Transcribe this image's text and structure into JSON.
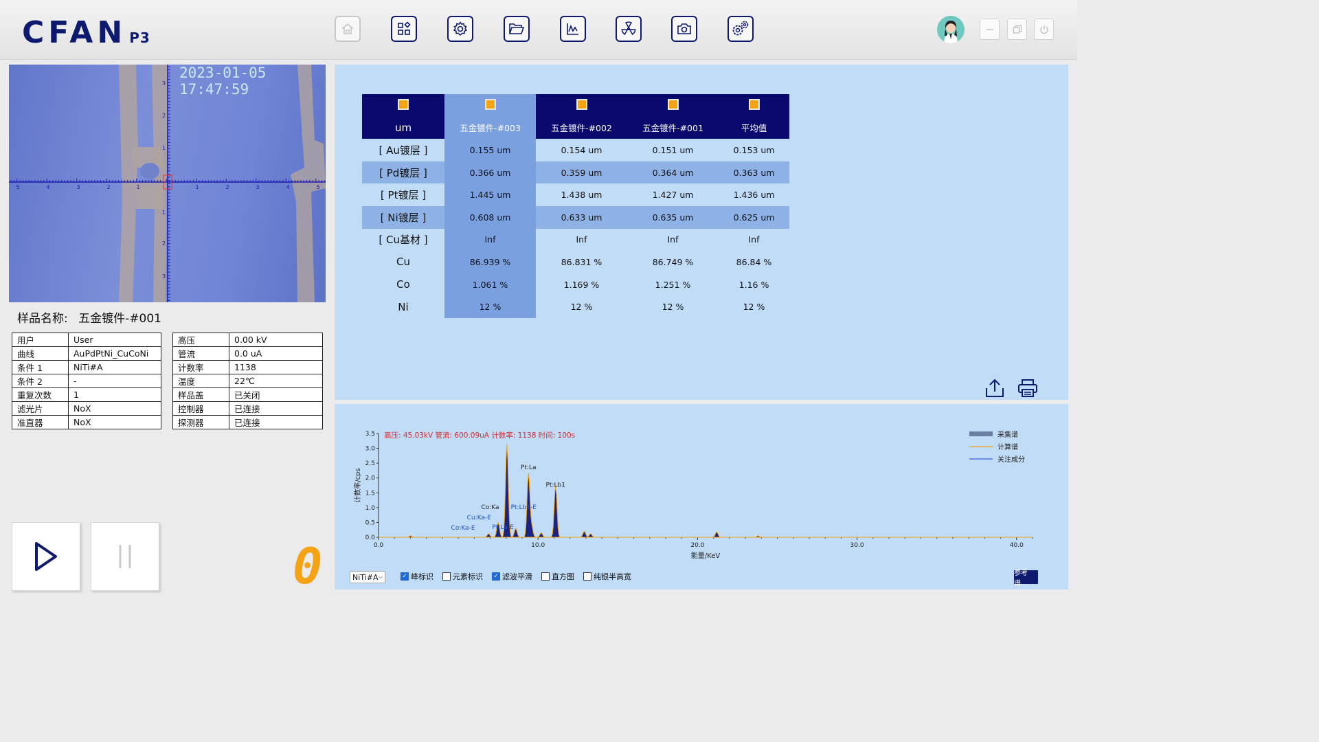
{
  "app": {
    "logo": "CFAN",
    "logo_sub": "P3"
  },
  "nav": [
    {
      "name": "home-icon",
      "enabled": false
    },
    {
      "name": "apps-icon",
      "enabled": true
    },
    {
      "name": "gear-icon",
      "enabled": true
    },
    {
      "name": "folder-open-icon",
      "enabled": true
    },
    {
      "name": "chart-icon",
      "enabled": true
    },
    {
      "name": "radiation-icon",
      "enabled": true
    },
    {
      "name": "camera-icon",
      "enabled": true
    },
    {
      "name": "gears-icon",
      "enabled": true
    }
  ],
  "camera": {
    "timestamp": "2023-01-05 17:47:59",
    "h_ticks": [
      "5",
      "4",
      "3",
      "2",
      "1",
      "1",
      "2",
      "3",
      "4",
      "5"
    ],
    "v_ticks": [
      "3",
      "2",
      "1",
      "1",
      "2",
      "3"
    ]
  },
  "sample": {
    "label": "样品名称:",
    "value": "五金镀件-#001"
  },
  "info_left": [
    {
      "k": "用户",
      "v": "User"
    },
    {
      "k": "曲线",
      "v": "AuPdPtNi_CuCoNi"
    },
    {
      "k": "条件 1",
      "v": "NiTi#A"
    },
    {
      "k": "条件 2",
      "v": "-"
    },
    {
      "k": "重复次数",
      "v": "1"
    },
    {
      "k": "滤光片",
      "v": "NoX"
    },
    {
      "k": "准直器",
      "v": "NoX"
    }
  ],
  "info_right": [
    {
      "k": "高压",
      "v": "0.00 kV"
    },
    {
      "k": "管流",
      "v": "0.0 uA"
    },
    {
      "k": "计数率",
      "v": "1138"
    },
    {
      "k": "温度",
      "v": "22℃"
    },
    {
      "k": "样品盖",
      "v": "已关闭"
    },
    {
      "k": "控制器",
      "v": "已连接"
    },
    {
      "k": "探测器",
      "v": "已连接"
    }
  ],
  "counter_digit": "0",
  "results": {
    "unit": "um",
    "columns": [
      "五金镀件-#003",
      "五金镀件-#002",
      "五金镀件-#001",
      "平均值"
    ],
    "rows": [
      {
        "label": "[ Au镀层 ]",
        "values": [
          "0.155 um",
          "0.154 um",
          "0.151 um",
          "0.153 um"
        ]
      },
      {
        "label": "[ Pd镀层 ]",
        "values": [
          "0.366 um",
          "0.359 um",
          "0.364 um",
          "0.363 um"
        ]
      },
      {
        "label": "[ Pt镀层 ]",
        "values": [
          "1.445 um",
          "1.438 um",
          "1.427 um",
          "1.436 um"
        ]
      },
      {
        "label": "[ Ni镀层 ]",
        "values": [
          "0.608 um",
          "0.633 um",
          "0.635 um",
          "0.625 um"
        ]
      },
      {
        "label": "[ Cu基材 ]",
        "values": [
          "Inf",
          "Inf",
          "Inf",
          "Inf"
        ]
      },
      {
        "label": "Cu",
        "values": [
          "86.939 %",
          "86.831 %",
          "86.749 %",
          "86.84 %"
        ]
      },
      {
        "label": "Co",
        "values": [
          "1.061 %",
          "1.169 %",
          "1.251 %",
          "1.16 %"
        ]
      },
      {
        "label": "Ni",
        "values": [
          "12 %",
          "12 %",
          "12 %",
          "12 %"
        ]
      }
    ]
  },
  "spectrum": {
    "status": "高压: 45.03kV 管流: 600.09uA 计数率: 1138 时间: 100s",
    "legend": [
      "采集谱",
      "计算谱",
      "关注成分"
    ],
    "condition_select": "NiTi#A",
    "options": [
      {
        "label": "峰标识",
        "checked": true
      },
      {
        "label": "元素标识",
        "checked": false
      },
      {
        "label": "滤波平滑",
        "checked": true
      },
      {
        "label": "直方图",
        "checked": false
      },
      {
        "label": "纯银半高宽",
        "checked": false
      }
    ],
    "ref_button": "参考谱..",
    "colors": {
      "acquired": "#1a237e",
      "calculated": "#f5a316",
      "focus": "#3b5bdb",
      "status": "#d32f2f"
    }
  },
  "chart_data": {
    "type": "line",
    "xlabel": "能量/KeV",
    "ylabel": "计数率/cps",
    "xlim": [
      0,
      41
    ],
    "ylim": [
      0,
      3.5
    ],
    "x_ticks": [
      "0.0",
      "10.0",
      "20.0",
      "30.0",
      "40.0"
    ],
    "y_ticks": [
      "0.0",
      "0.5",
      "1.0",
      "1.5",
      "2.0",
      "2.5",
      "3.0",
      "3.5"
    ],
    "series": [
      {
        "name": "采集谱",
        "x": [
          0,
          2.0,
          6.9,
          7.5,
          8.05,
          8.6,
          9.4,
          9.6,
          10.2,
          11.1,
          12.9,
          13.3,
          21.2,
          23.8,
          41
        ],
        "values": [
          0,
          0.05,
          0.12,
          0.5,
          3.15,
          0.3,
          2.15,
          0.35,
          0.15,
          1.75,
          0.2,
          0.12,
          0.18,
          0.05,
          0
        ]
      }
    ],
    "peak_labels": [
      {
        "label": "Pt:La",
        "x": 9.4,
        "y": 2.3
      },
      {
        "label": "Pt:Lb1",
        "x": 11.1,
        "y": 1.7
      },
      {
        "label": "Co:Ka",
        "x": 7.0,
        "y": 0.95
      },
      {
        "label": "Cu:Ka-E",
        "x": 6.3,
        "y": 0.6
      },
      {
        "label": "Pt:Lb1-E",
        "x": 9.1,
        "y": 0.95
      },
      {
        "label": "Co:Ka-E",
        "x": 5.3,
        "y": 0.25
      },
      {
        "label": "Pt:La-E",
        "x": 7.8,
        "y": 0.28
      }
    ]
  }
}
